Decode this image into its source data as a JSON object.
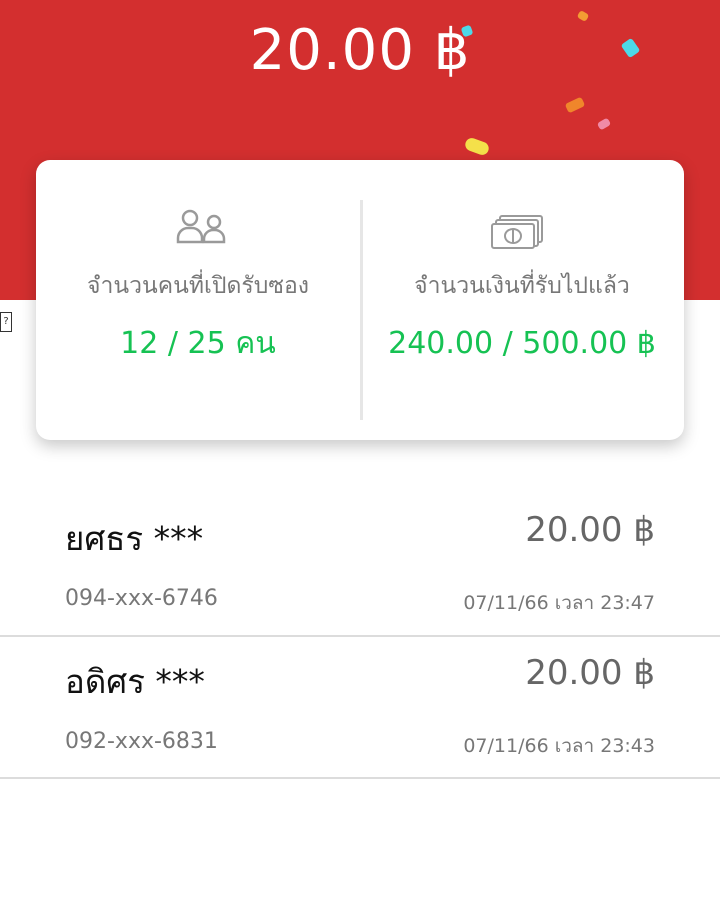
{
  "header": {
    "amount": "20.00 ฿",
    "background_color": "#d32f2f"
  },
  "summary": {
    "openers_label": "จำนวนคนที่เปิดรับซอง",
    "openers_value": "12 / 25 คน",
    "money_label": "จำนวนเงินที่รับไปแล้ว",
    "money_value": "240.00 / 500.00 ฿",
    "accent_color": "#16c253",
    "icons": [
      "people-icon",
      "banknote-icon"
    ]
  },
  "recipients": [
    {
      "name": "ยศธร ***",
      "phone": "094-xxx-6746",
      "amount": "20.00 ฿",
      "time": "07/11/66 เวลา 23:47"
    },
    {
      "name": "อดิศร ***",
      "phone": "092-xxx-6831",
      "amount": "20.00 ฿",
      "time": "07/11/66 เวลา 23:43"
    },
    {
      "name": "",
      "phone": "",
      "amount": "",
      "time": ""
    }
  ]
}
